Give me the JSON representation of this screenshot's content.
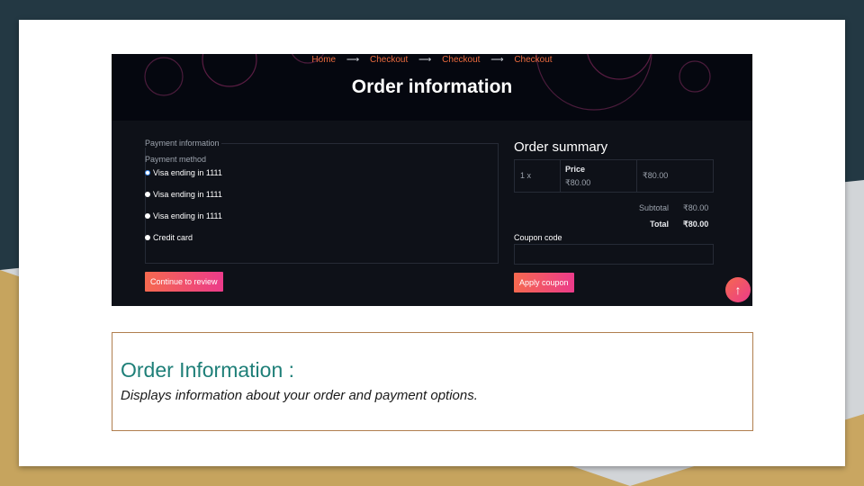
{
  "breadcrumb": [
    {
      "label": "Home"
    },
    {
      "label": "Checkout"
    },
    {
      "label": "Checkout"
    },
    {
      "label": "Checkout"
    }
  ],
  "breadcrumb_separator": "⟶",
  "page_title": "Order information",
  "payment": {
    "section_label": "Payment information",
    "method_label": "Payment method",
    "options": [
      {
        "label": "Visa ending in 1111",
        "selected": true
      },
      {
        "label": "Visa ending in 1111",
        "selected": false
      },
      {
        "label": "Visa ending in 1111",
        "selected": false
      },
      {
        "label": "Credit card",
        "selected": false
      }
    ],
    "continue_label": "Continue to review"
  },
  "summary": {
    "title": "Order summary",
    "item": {
      "qty": "1 x",
      "price_header": "Price",
      "price": "₹80.00",
      "line_total": "₹80.00"
    },
    "subtotal_label": "Subtotal",
    "subtotal_value": "₹80.00",
    "total_label": "Total",
    "total_value": "₹80.00",
    "coupon_label": "Coupon code",
    "coupon_value": "",
    "apply_label": "Apply coupon"
  },
  "scroll_top_icon": "↑",
  "caption": {
    "title": "Order Information :",
    "text": "Displays information about your order and payment options."
  },
  "colors": {
    "accent": "#e96a3e",
    "gradient_start": "#f5694f",
    "gradient_end": "#ec3b8a",
    "caption_title": "#1e7f78",
    "caption_border": "#b07e4e",
    "slide_bg": "#233843",
    "panel_bg": "#0e1118"
  }
}
